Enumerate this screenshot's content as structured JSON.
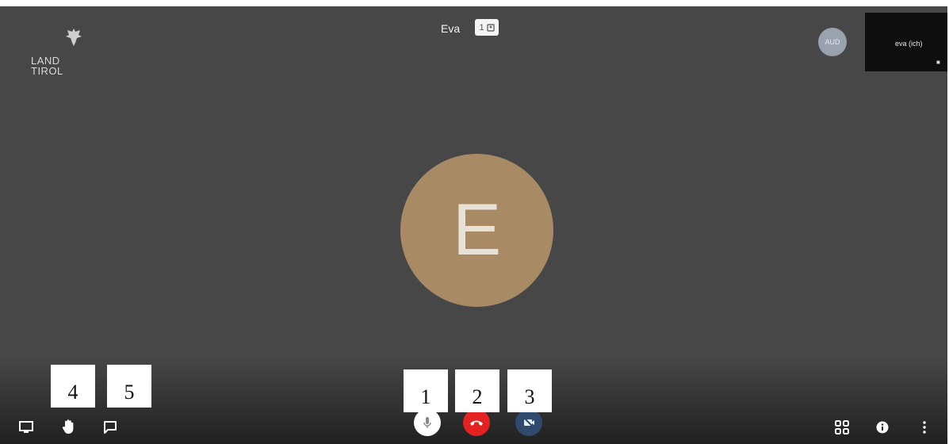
{
  "logo": {
    "line1": "LAND",
    "line2": "TIROL"
  },
  "header": {
    "participant_name": "Eva",
    "participant_count": "1"
  },
  "top_right": {
    "avatar_initials": "AUD",
    "thumbnail_label": "eva (ich)"
  },
  "main_avatar": {
    "initial": "E"
  },
  "toolbar": {
    "left": [
      "screen-share-icon",
      "raise-hand-icon",
      "chat-icon"
    ],
    "center": [
      "microphone-icon",
      "hangup-icon",
      "camera-off-icon"
    ],
    "right": [
      "tile-view-icon",
      "info-icon",
      "more-icon"
    ],
    "colors": {
      "hangup": "#e52222",
      "camera": "#2f4a6d",
      "avatar": "#a88b65"
    }
  },
  "callouts": [
    "1",
    "2",
    "3",
    "4",
    "5"
  ]
}
